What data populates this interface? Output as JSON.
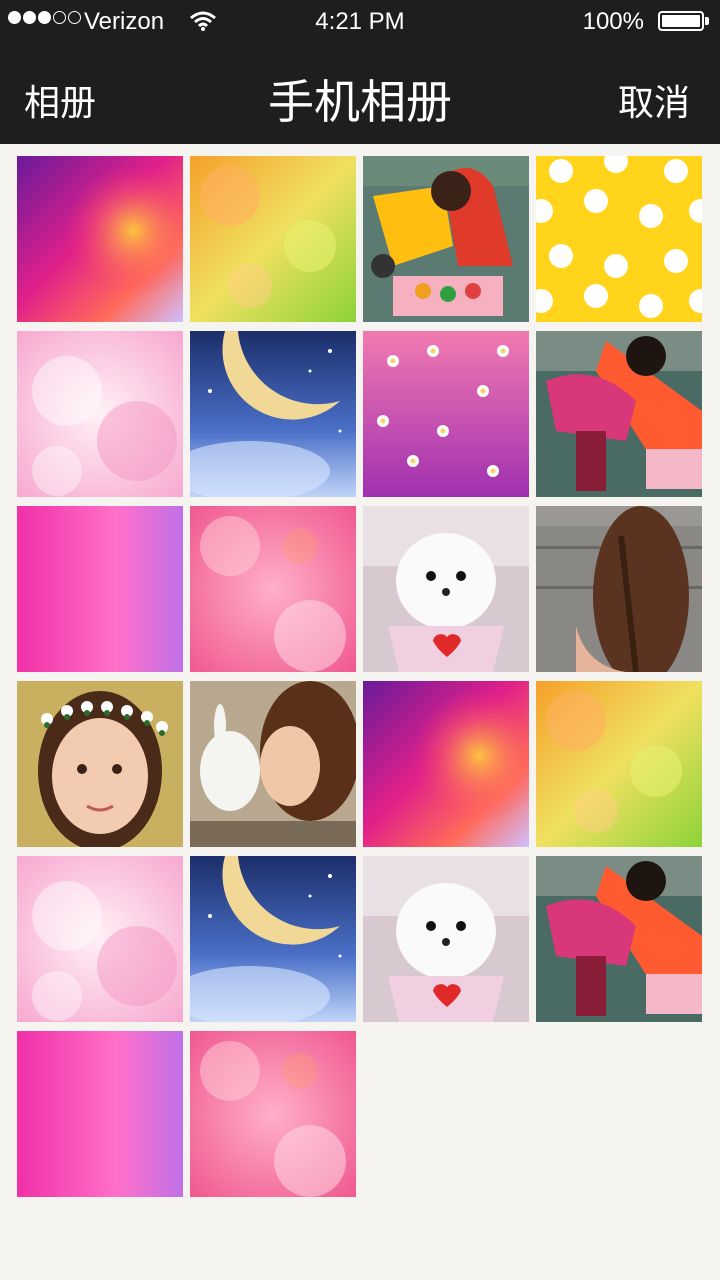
{
  "status_bar": {
    "signal_dots": "●●●○○",
    "carrier": "Verizon",
    "time": "4:21 PM",
    "battery": "100%"
  },
  "nav": {
    "back_label": "相册",
    "title": "手机相册",
    "cancel_label": "取消"
  },
  "photos": [
    {
      "type": "gradient-magenta"
    },
    {
      "type": "bokeh-green"
    },
    {
      "type": "child-toy"
    },
    {
      "type": "yellow-polka-dot"
    },
    {
      "type": "pink-clouds"
    },
    {
      "type": "moon-night"
    },
    {
      "type": "pink-flowers"
    },
    {
      "type": "child-slide"
    },
    {
      "type": "pink-gradient"
    },
    {
      "type": "pink-clouds-2"
    },
    {
      "type": "white-puppy"
    },
    {
      "type": "braided-hair"
    },
    {
      "type": "girl-flower-crown"
    },
    {
      "type": "girl-rabbit"
    },
    {
      "type": "gradient-magenta"
    },
    {
      "type": "bokeh-green"
    },
    {
      "type": "pink-clouds"
    },
    {
      "type": "moon-night"
    },
    {
      "type": "white-puppy"
    },
    {
      "type": "child-slide"
    },
    {
      "type": "pink-gradient"
    },
    {
      "type": "pink-clouds-2"
    }
  ]
}
